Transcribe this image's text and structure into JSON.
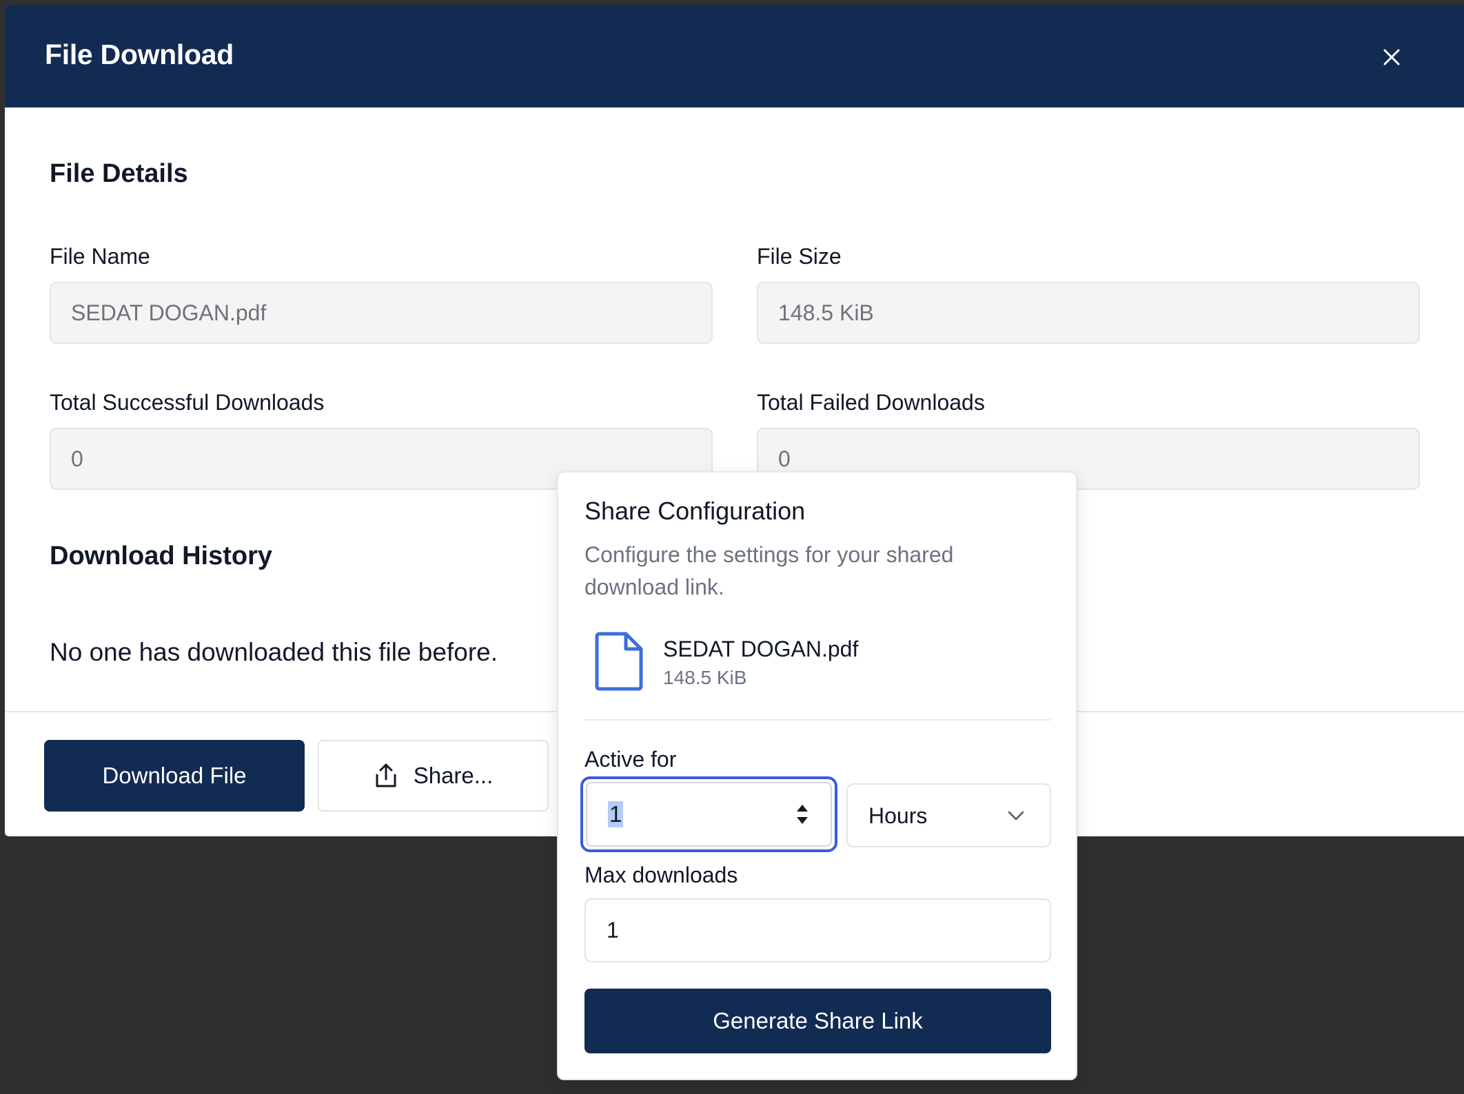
{
  "modal": {
    "title": "File Download",
    "close_icon": "close-icon"
  },
  "details": {
    "section_title": "File Details",
    "file_name_label": "File Name",
    "file_name_value": "SEDAT DOGAN.pdf",
    "file_size_label": "File Size",
    "file_size_value": "148.5 KiB",
    "successful_label": "Total Successful Downloads",
    "successful_value": "0",
    "failed_label": "Total Failed Downloads",
    "failed_value": "0"
  },
  "history": {
    "section_title": "Download History",
    "empty_text": "No one has downloaded this file before."
  },
  "footer": {
    "download_label": "Download File",
    "share_label": "Share...",
    "share_icon": "share-upload-icon"
  },
  "share_popover": {
    "title": "Share Configuration",
    "description": "Configure the settings for your shared download link.",
    "file_icon": "file-icon",
    "file_name": "SEDAT DOGAN.pdf",
    "file_size": "148.5 KiB",
    "active_for_label": "Active for",
    "active_for_value": "1",
    "unit_selected": "Hours",
    "max_downloads_label": "Max downloads",
    "max_downloads_value": "1",
    "generate_label": "Generate Share Link"
  },
  "colors": {
    "header_bg": "#122b53",
    "primary_button": "#122b53",
    "focus_ring": "#3b5bdb",
    "file_icon": "#3b6fd9",
    "backdrop": "#2f2f2f"
  }
}
